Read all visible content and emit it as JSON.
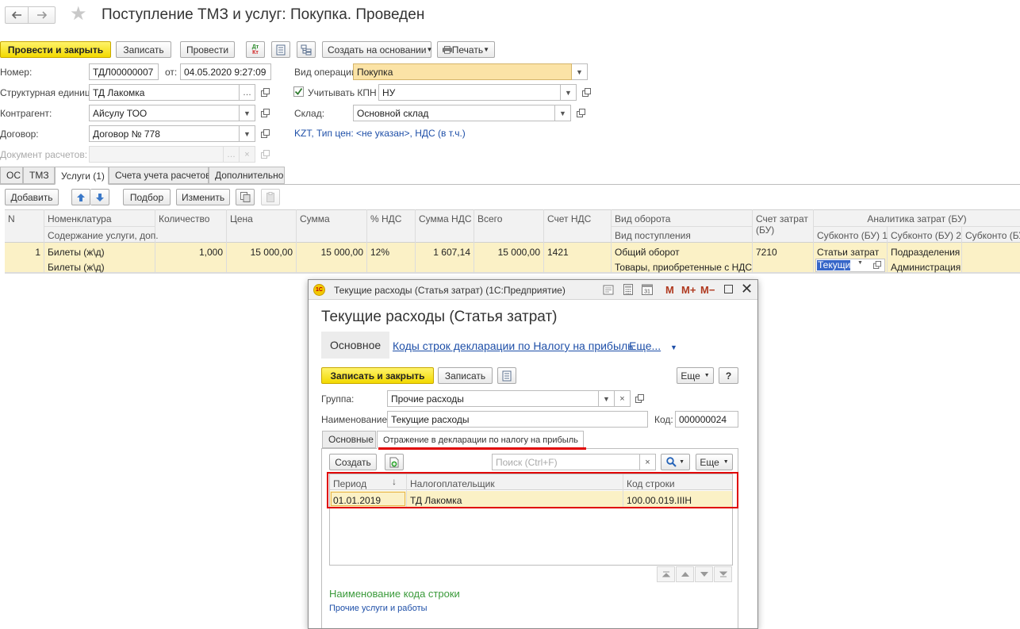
{
  "main": {
    "title": "Поступление ТМЗ и услуг: Покупка. Проведен",
    "toolbar": {
      "post_close": "Провести и закрыть",
      "save": "Записать",
      "post": "Провести",
      "create_based": "Создать на основании",
      "print": "Печать",
      "dtkt_top": "Дт",
      "dtkt_bottom": "Кт"
    },
    "fields": {
      "number_label": "Номер:",
      "number_value": "ТДЛ00000007",
      "date_label": "от:",
      "date_value": "04.05.2020  9:27:09",
      "optype_label": "Вид операции:",
      "optype_value": "Покупка",
      "unit_label": "Структурная единица:",
      "unit_value": "ТД Лакомка",
      "kpn_label": "Учитывать КПН",
      "kpn_value": "НУ",
      "contractor_label": "Контрагент:",
      "contractor_value": "Айсулу ТОО",
      "warehouse_label": "Склад:",
      "warehouse_value": "Основной склад",
      "contract_label": "Договор:",
      "contract_value": "Договор № 778",
      "price_info": "KZT, Тип цен: <не указан>, НДС (в т.ч.)",
      "settlement_label": "Документ расчетов:",
      "settlement_value": ""
    },
    "tabs": [
      "ОС",
      "ТМЗ",
      "Услуги (1)",
      "Счета учета расчетов",
      "Дополнительно"
    ],
    "table_toolbar": {
      "add": "Добавить",
      "select": "Подбор",
      "change": "Изменить"
    },
    "table": {
      "headers": {
        "n": "N",
        "nom": "Номенклатура",
        "nom2": "Содержание услуги, доп.",
        "qty": "Количество",
        "price": "Цена",
        "sum": "Сумма",
        "vat_pct": "% НДС",
        "vat_sum": "Сумма НДС",
        "total": "Всего",
        "vat_acc": "Счет НДС",
        "turnover": "Вид оборота",
        "receipt": "Вид поступления",
        "cost_acc": "Счет затрат (БУ)",
        "analytics": "Аналитика затрат (БУ)",
        "sub1": "Субконто (БУ) 1",
        "sub2": "Субконто (БУ) 2",
        "sub3": "Субконто (БУ"
      },
      "row": {
        "n": "1",
        "nom": "Билеты (ж\\д)",
        "nom2": "Билеты (ж\\д)",
        "qty": "1,000",
        "price": "15 000,00",
        "sum": "15 000,00",
        "vat_pct": "12%",
        "vat_sum": "1 607,14",
        "total": "15 000,00",
        "vat_acc": "1421",
        "turnover": "Общий оборот",
        "receipt": "Товары, приобретенные с НДС",
        "cost_acc": "7210",
        "sub1_top": "Статьи затрат",
        "sub1_edit": "Текущие",
        "sub2_top": "Подразделения",
        "sub2_bottom": "Администрация"
      }
    }
  },
  "dialog": {
    "window_title": "Текущие расходы (Статья затрат)  (1С:Предприятие)",
    "logo": "1С",
    "title_m": "M",
    "title_mplus": "M+",
    "title_mminus": "M−",
    "heading": "Текущие расходы (Статья затрат)",
    "nav": {
      "main": "Основное",
      "codes": "Коды строк декларации по Налогу на прибыль",
      "more": "Еще..."
    },
    "toolbar": {
      "save_close": "Записать и закрыть",
      "save": "Записать",
      "more": "Еще",
      "help": "?"
    },
    "fields": {
      "group_label": "Группа:",
      "group_value": "Прочие расходы",
      "name_label": "Наименование:",
      "name_value": "Текущие расходы",
      "code_label": "Код:",
      "code_value": "000000024"
    },
    "tabs": [
      "Основные",
      "Отражение в декларации по налогу на прибыль"
    ],
    "sub_toolbar": {
      "create": "Создать",
      "search_placeholder": "Поиск (Ctrl+F)",
      "more": "Еще"
    },
    "table": {
      "headers": [
        "Период",
        "Налогоплательщик",
        "Код строки"
      ],
      "rows": [
        {
          "period": "01.01.2019",
          "taxpayer": "ТД Лакомка",
          "code": "100.00.019.IIIН"
        }
      ]
    },
    "code_name_label": "Наименование кода строки",
    "code_name_value": "Прочие услуги и работы"
  },
  "colors": {
    "accent_yellow": "#f2d900",
    "row_highlight": "#fbf1c6",
    "field_highlight": "#fbe3a6",
    "link_blue": "#1e4fa8",
    "annotation_red": "#e00000",
    "code_name_green": "#3a9a3a"
  }
}
